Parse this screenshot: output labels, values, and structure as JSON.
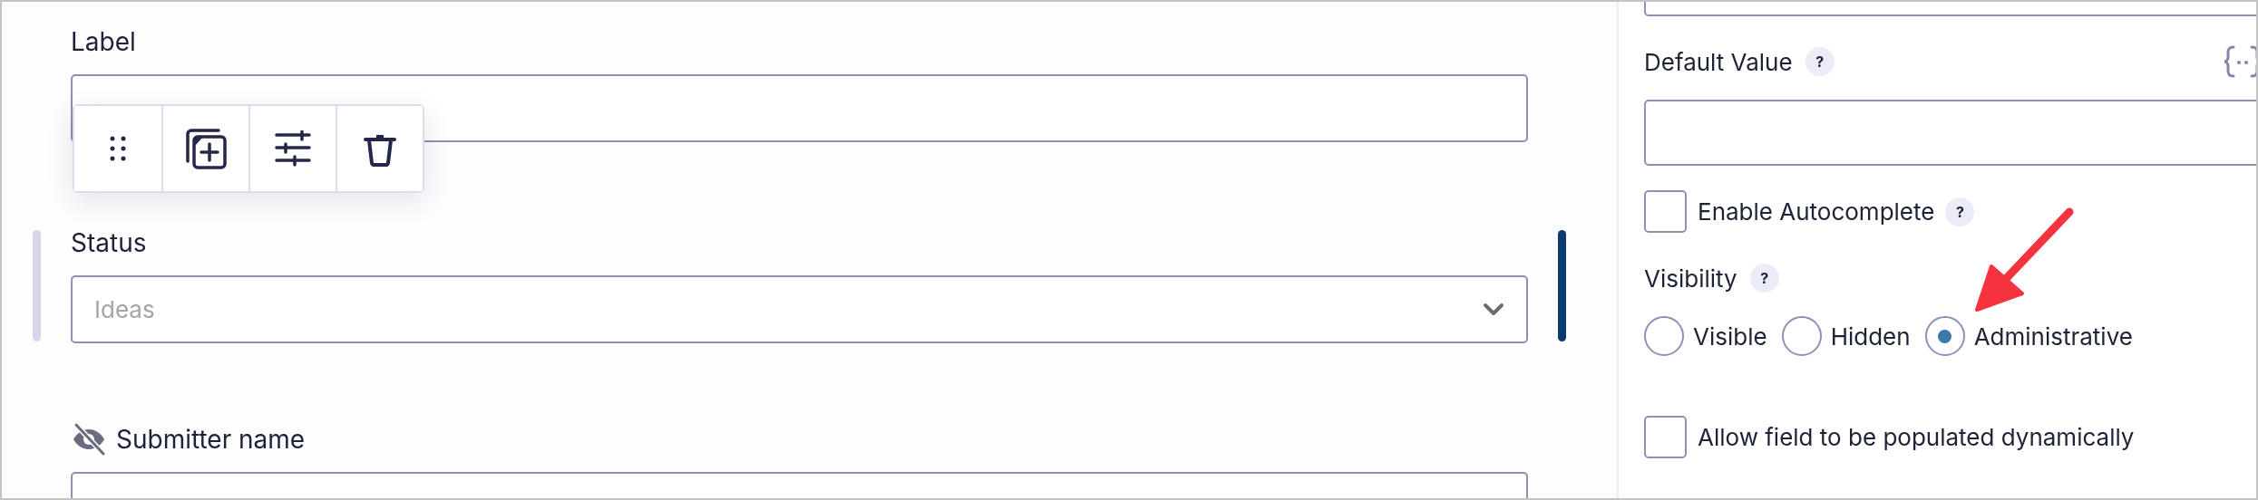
{
  "form_fields": [
    {
      "kind": "text",
      "label": "Label",
      "hidden": false,
      "selected": false
    },
    {
      "kind": "select",
      "label": "Status",
      "placeholder": "Ideas",
      "hidden": false,
      "selected": true
    },
    {
      "kind": "text",
      "label": "Submitter name",
      "hidden": true,
      "selected": false
    }
  ],
  "field_toolbar": {
    "buttons": [
      {
        "kind": "drag"
      },
      {
        "kind": "duplicate"
      },
      {
        "kind": "settings"
      },
      {
        "kind": "delete"
      }
    ]
  },
  "settings_panel": {
    "items": [
      {
        "kind": "input",
        "clipped_top": true
      },
      {
        "kind": "heading",
        "label": "Default Value",
        "help": "?",
        "merge_tags": true
      },
      {
        "kind": "input",
        "clipped_top": false
      },
      {
        "kind": "checkbox",
        "label": "Enable Autocomplete",
        "help": "?",
        "checked": false
      },
      {
        "kind": "heading",
        "label": "Visibility",
        "help": "?",
        "merge_tags": false
      },
      {
        "kind": "radios",
        "options": [
          {
            "label": "Visible",
            "selected": false
          },
          {
            "label": "Hidden",
            "selected": false
          },
          {
            "label": "Administrative",
            "selected": true
          }
        ]
      },
      {
        "kind": "checkbox",
        "label": "Allow field to be populated dynamically",
        "checked": false
      }
    ]
  },
  "annotation": {
    "kind": "arrow"
  }
}
